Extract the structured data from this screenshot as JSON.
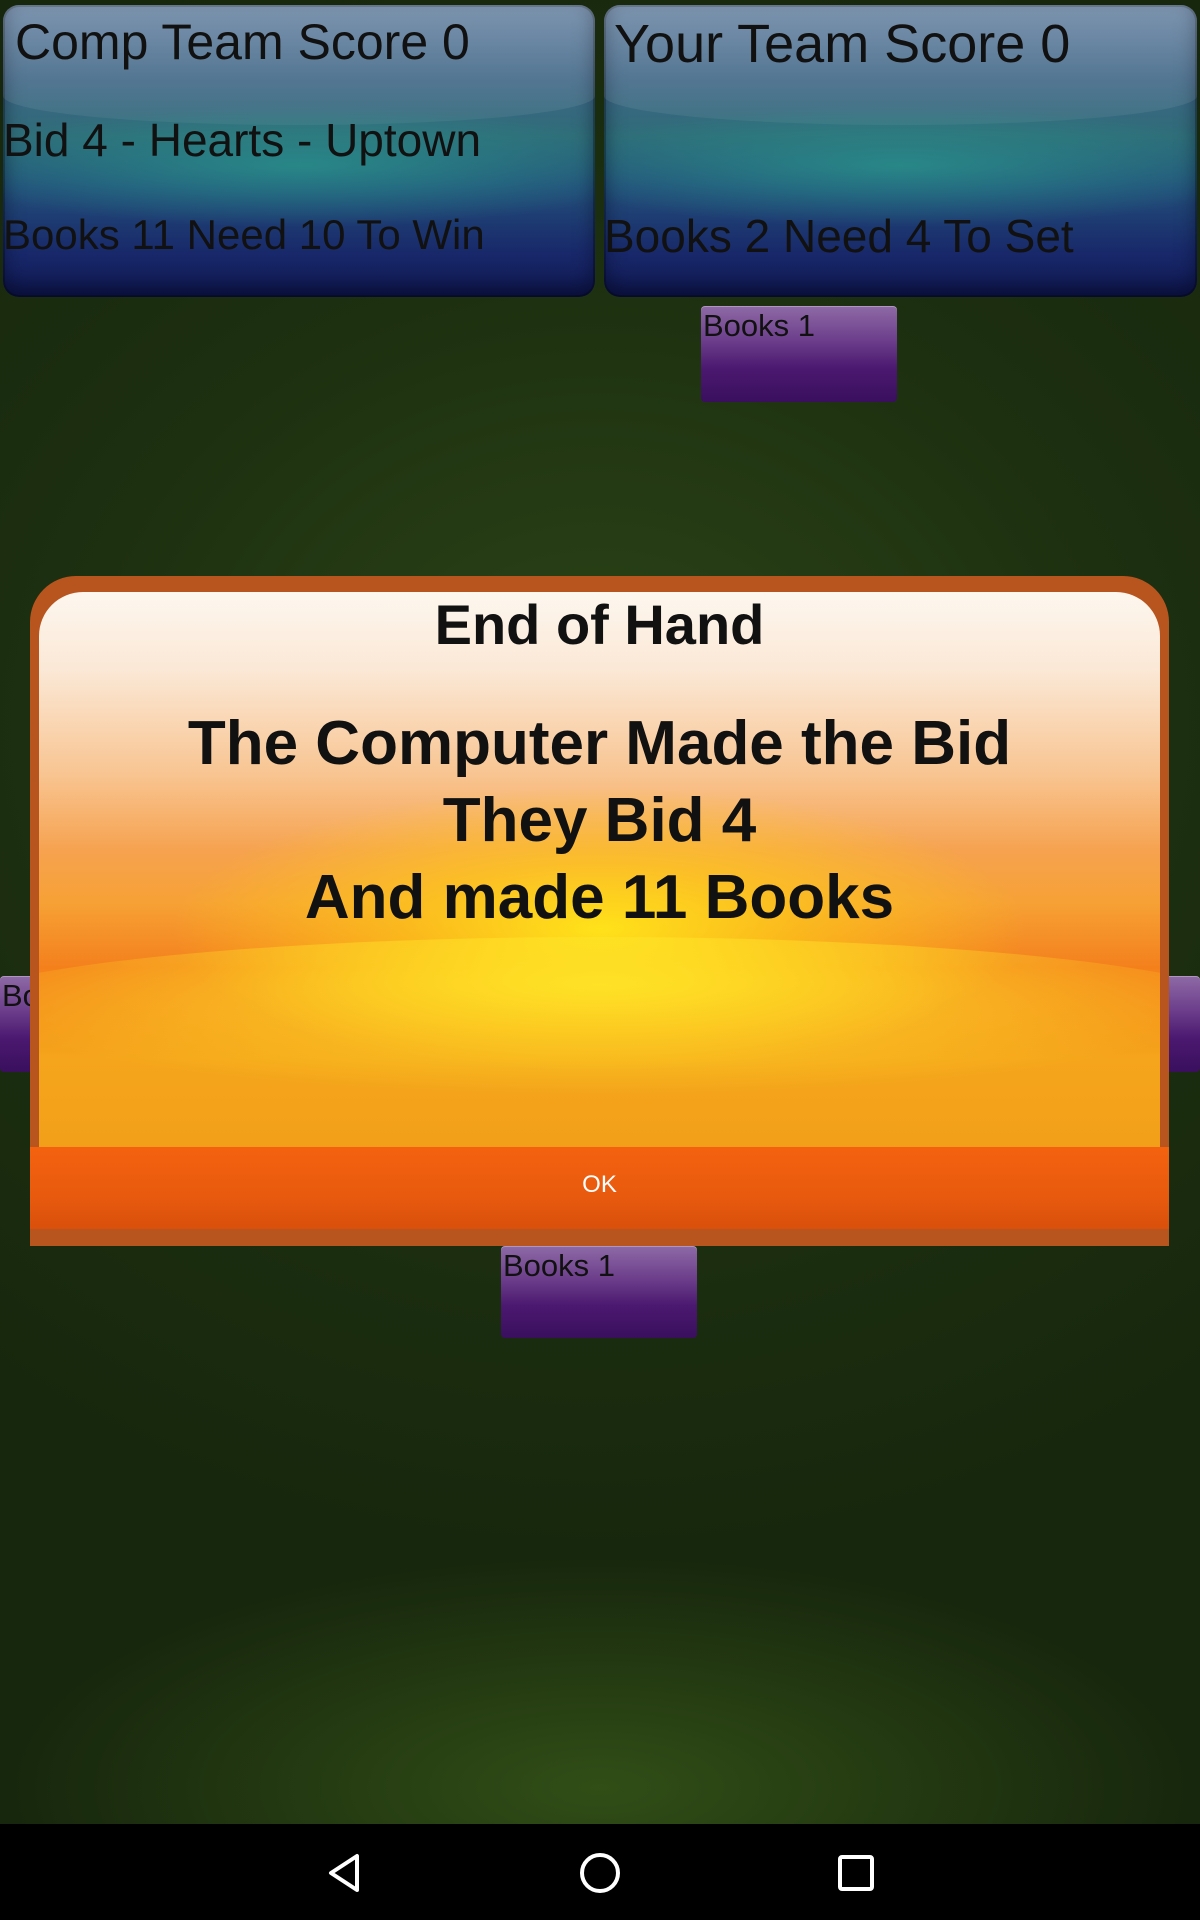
{
  "comp_team": {
    "score": "Comp Team Score 0",
    "bid": "Bid 4 - Hearts - Uptown",
    "books": "Books 11 Need 10 To Win"
  },
  "your_team": {
    "score": "Your Team Score 0",
    "books": "Books 2 Need 4 To Set"
  },
  "player_books": {
    "top": "Books 1",
    "left": "Bo",
    "bottom": "Books 1"
  },
  "dialog": {
    "title": "End of Hand",
    "line1": "The Computer Made the Bid",
    "line2": "They Bid 4",
    "line3": "And made 11 Books",
    "ok_label": "OK"
  },
  "navbar": {
    "back_icon": "back-triangle-icon",
    "home_icon": "home-circle-icon",
    "recents_icon": "recents-square-icon"
  },
  "colors": {
    "felt": "#1f3412",
    "panel_blue": "#234f7a",
    "books_purple": "#4b1970",
    "dialog_frame": "#b8551f",
    "ok_bar": "#f4620f"
  }
}
